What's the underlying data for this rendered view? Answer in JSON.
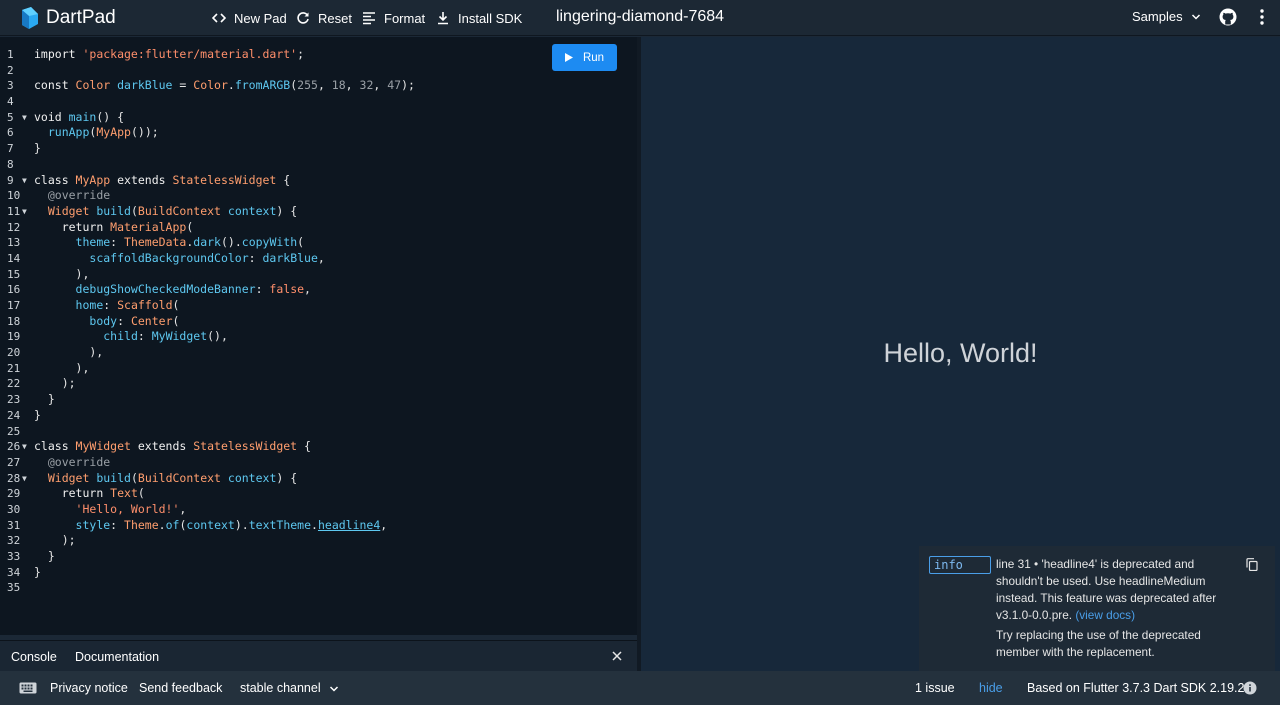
{
  "app": {
    "name": "DartPad",
    "pad_title": "lingering-diamond-7684"
  },
  "toolbar": {
    "new_pad": "New Pad",
    "reset": "Reset",
    "format": "Format",
    "install_sdk": "Install SDK",
    "samples": "Samples"
  },
  "editor": {
    "run_label": "Run",
    "lines": [
      {
        "n": "1",
        "fold": false,
        "tokens": [
          [
            "k",
            "import "
          ],
          [
            "s",
            "'package:flutter/material.dart'"
          ],
          [
            "src",
            ";"
          ]
        ]
      },
      {
        "n": "2",
        "fold": false,
        "tokens": []
      },
      {
        "n": "3",
        "fold": false,
        "tokens": [
          [
            "k",
            "const "
          ],
          [
            "t",
            "Color "
          ],
          [
            "f",
            "darkBlue "
          ],
          [
            "src",
            "= "
          ],
          [
            "t",
            "Color"
          ],
          [
            "src",
            "."
          ],
          [
            "f",
            "fromARGB"
          ],
          [
            "src",
            "("
          ],
          [
            "n",
            "255"
          ],
          [
            "src",
            ", "
          ],
          [
            "n",
            "18"
          ],
          [
            "src",
            ", "
          ],
          [
            "n",
            "32"
          ],
          [
            "src",
            ", "
          ],
          [
            "n",
            "47"
          ],
          [
            "src",
            ");"
          ]
        ]
      },
      {
        "n": "4",
        "fold": false,
        "tokens": []
      },
      {
        "n": "5",
        "fold": true,
        "tokens": [
          [
            "k",
            "void "
          ],
          [
            "f",
            "main"
          ],
          [
            "src",
            "() {"
          ]
        ]
      },
      {
        "n": "6",
        "fold": false,
        "tokens": [
          [
            "src",
            "  "
          ],
          [
            "f",
            "runApp"
          ],
          [
            "src",
            "("
          ],
          [
            "t",
            "MyApp"
          ],
          [
            "src",
            "());"
          ]
        ]
      },
      {
        "n": "7",
        "fold": false,
        "tokens": [
          [
            "src",
            "}"
          ]
        ]
      },
      {
        "n": "8",
        "fold": false,
        "tokens": []
      },
      {
        "n": "9",
        "fold": true,
        "tokens": [
          [
            "k",
            "class "
          ],
          [
            "t",
            "MyApp "
          ],
          [
            "k",
            "extends "
          ],
          [
            "t",
            "StatelessWidget "
          ],
          [
            "src",
            "{"
          ]
        ]
      },
      {
        "n": "10",
        "fold": false,
        "tokens": [
          [
            "src",
            "  "
          ],
          [
            "a",
            "@override"
          ]
        ]
      },
      {
        "n": "11",
        "fold": true,
        "tokens": [
          [
            "src",
            "  "
          ],
          [
            "t",
            "Widget "
          ],
          [
            "f",
            "build"
          ],
          [
            "src",
            "("
          ],
          [
            "t",
            "BuildContext "
          ],
          [
            "f",
            "context"
          ],
          [
            "src",
            ") {"
          ]
        ]
      },
      {
        "n": "12",
        "fold": false,
        "tokens": [
          [
            "src",
            "    "
          ],
          [
            "k",
            "return "
          ],
          [
            "t",
            "MaterialApp"
          ],
          [
            "src",
            "("
          ]
        ]
      },
      {
        "n": "13",
        "fold": false,
        "tokens": [
          [
            "src",
            "      "
          ],
          [
            "p",
            "theme"
          ],
          [
            "src",
            ": "
          ],
          [
            "t",
            "ThemeData"
          ],
          [
            "src",
            "."
          ],
          [
            "f",
            "dark"
          ],
          [
            "src",
            "()."
          ],
          [
            "f",
            "copyWith"
          ],
          [
            "src",
            "("
          ]
        ]
      },
      {
        "n": "14",
        "fold": false,
        "tokens": [
          [
            "src",
            "        "
          ],
          [
            "p",
            "scaffoldBackgroundColor"
          ],
          [
            "src",
            ": "
          ],
          [
            "f",
            "darkBlue"
          ],
          [
            "src",
            ","
          ]
        ]
      },
      {
        "n": "15",
        "fold": false,
        "tokens": [
          [
            "src",
            "      ),"
          ]
        ]
      },
      {
        "n": "16",
        "fold": false,
        "tokens": [
          [
            "src",
            "      "
          ],
          [
            "p",
            "debugShowCheckedModeBanner"
          ],
          [
            "src",
            ": "
          ],
          [
            "b",
            "false"
          ],
          [
            "src",
            ","
          ]
        ]
      },
      {
        "n": "17",
        "fold": false,
        "tokens": [
          [
            "src",
            "      "
          ],
          [
            "p",
            "home"
          ],
          [
            "src",
            ": "
          ],
          [
            "t",
            "Scaffold"
          ],
          [
            "src",
            "("
          ]
        ]
      },
      {
        "n": "18",
        "fold": false,
        "tokens": [
          [
            "src",
            "        "
          ],
          [
            "p",
            "body"
          ],
          [
            "src",
            ": "
          ],
          [
            "t",
            "Center"
          ],
          [
            "src",
            "("
          ]
        ]
      },
      {
        "n": "19",
        "fold": false,
        "tokens": [
          [
            "src",
            "          "
          ],
          [
            "p",
            "child"
          ],
          [
            "src",
            ": "
          ],
          [
            "f",
            "MyWidget"
          ],
          [
            "src",
            "(),"
          ]
        ]
      },
      {
        "n": "20",
        "fold": false,
        "tokens": [
          [
            "src",
            "        ),"
          ]
        ]
      },
      {
        "n": "21",
        "fold": false,
        "tokens": [
          [
            "src",
            "      ),"
          ]
        ]
      },
      {
        "n": "22",
        "fold": false,
        "tokens": [
          [
            "src",
            "    );"
          ]
        ]
      },
      {
        "n": "23",
        "fold": false,
        "tokens": [
          [
            "src",
            "  }"
          ]
        ]
      },
      {
        "n": "24",
        "fold": false,
        "tokens": [
          [
            "src",
            "}"
          ]
        ]
      },
      {
        "n": "25",
        "fold": false,
        "tokens": []
      },
      {
        "n": "26",
        "fold": true,
        "tokens": [
          [
            "k",
            "class "
          ],
          [
            "t",
            "MyWidget "
          ],
          [
            "k",
            "extends "
          ],
          [
            "t",
            "StatelessWidget "
          ],
          [
            "src",
            "{"
          ]
        ]
      },
      {
        "n": "27",
        "fold": false,
        "tokens": [
          [
            "src",
            "  "
          ],
          [
            "a",
            "@override"
          ]
        ]
      },
      {
        "n": "28",
        "fold": true,
        "tokens": [
          [
            "src",
            "  "
          ],
          [
            "t",
            "Widget "
          ],
          [
            "f",
            "build"
          ],
          [
            "src",
            "("
          ],
          [
            "t",
            "BuildContext "
          ],
          [
            "f",
            "context"
          ],
          [
            "src",
            ") {"
          ]
        ]
      },
      {
        "n": "29",
        "fold": false,
        "tokens": [
          [
            "src",
            "    "
          ],
          [
            "k",
            "return "
          ],
          [
            "t",
            "Text"
          ],
          [
            "src",
            "("
          ]
        ]
      },
      {
        "n": "30",
        "fold": false,
        "tokens": [
          [
            "src",
            "      "
          ],
          [
            "s",
            "'Hello, World!'"
          ],
          [
            "src",
            ","
          ]
        ]
      },
      {
        "n": "31",
        "fold": false,
        "tokens": [
          [
            "src",
            "      "
          ],
          [
            "p",
            "style"
          ],
          [
            "src",
            ": "
          ],
          [
            "t",
            "Theme"
          ],
          [
            "src",
            "."
          ],
          [
            "f",
            "of"
          ],
          [
            "src",
            "("
          ],
          [
            "f",
            "context"
          ],
          [
            "src",
            ")."
          ],
          [
            "f",
            "textTheme"
          ],
          [
            "src",
            "."
          ],
          [
            "u",
            "headline4"
          ],
          [
            "src",
            ","
          ]
        ]
      },
      {
        "n": "32",
        "fold": false,
        "tokens": [
          [
            "src",
            "    );"
          ]
        ]
      },
      {
        "n": "33",
        "fold": false,
        "tokens": [
          [
            "src",
            "  }"
          ]
        ]
      },
      {
        "n": "34",
        "fold": false,
        "tokens": [
          [
            "src",
            "}"
          ]
        ]
      },
      {
        "n": "35",
        "fold": false,
        "tokens": []
      }
    ]
  },
  "output": {
    "text": "Hello, World!"
  },
  "issue": {
    "badge": "info",
    "message": "line 31 • 'headline4' is deprecated and shouldn't be used. Use headlineMedium instead. This feature was deprecated after v3.1.0-0.0.pre.",
    "link": "(view docs)",
    "fix": "Try replacing the use of the deprecated member with the replacement."
  },
  "console_bar": {
    "console": "Console",
    "documentation": "Documentation"
  },
  "statusbar": {
    "privacy": "Privacy notice",
    "feedback": "Send feedback",
    "channel": "stable channel",
    "issues": "1 issue",
    "hide": "hide",
    "sdk": "Based on Flutter 3.7.3 Dart SDK 2.19.2"
  },
  "colors": {
    "accent": "#1d8bf2",
    "editor_bg": "#0d1620",
    "output_bg": "#17283a"
  }
}
